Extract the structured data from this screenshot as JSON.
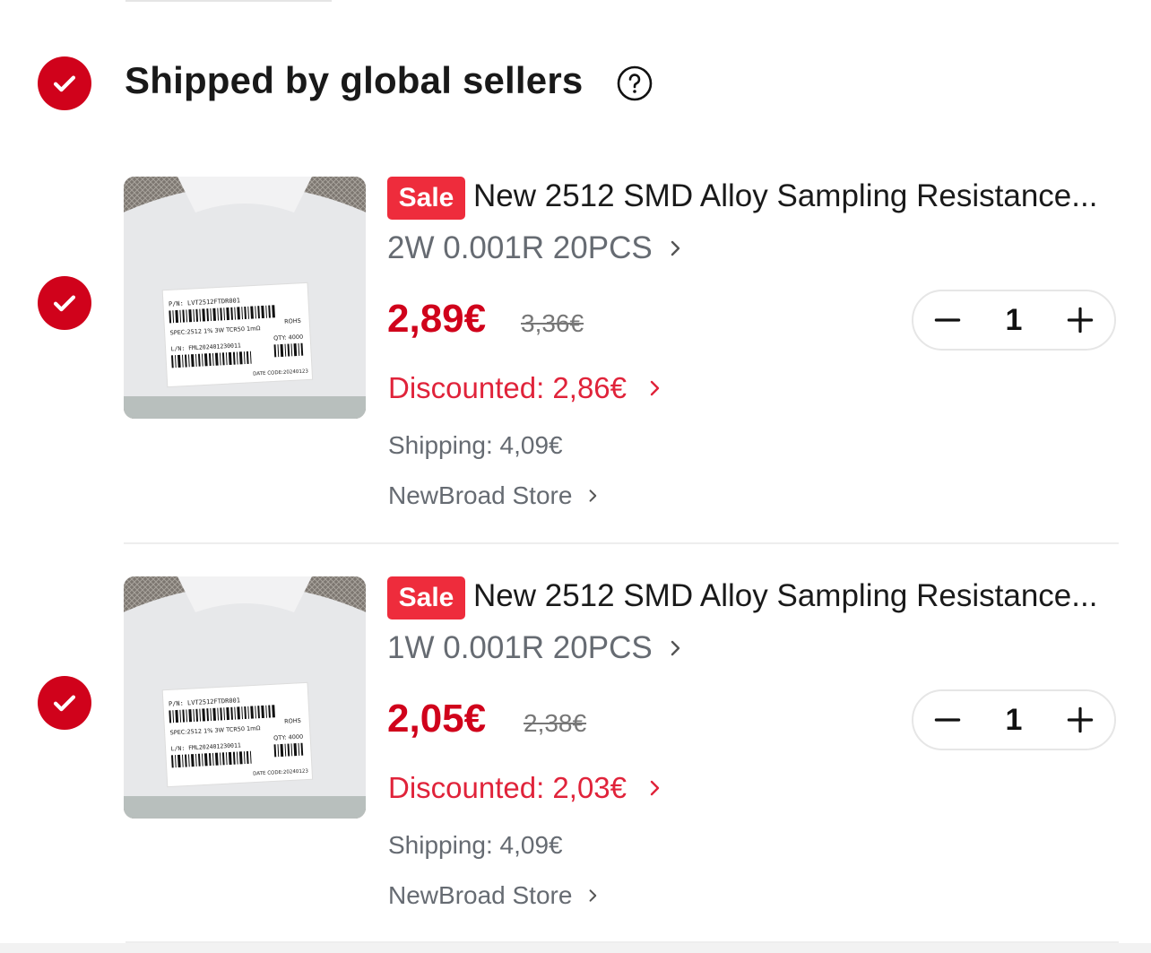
{
  "section": {
    "title": "Shipped by global sellers",
    "help_icon": "question-circle-icon",
    "checked": true
  },
  "colors": {
    "accent": "#d0021b",
    "sale_badge": "#ee2c3c",
    "discount_text": "#e0233a",
    "muted_text": "#666b72"
  },
  "items": [
    {
      "checked": true,
      "image_label": {
        "pn": "P/N: LVT2512FTDR001",
        "spec": "SPEC:2512 1% 3W TCR50 1mΩ",
        "rohs": "ROHS",
        "ln": "L/N: FML202401230011",
        "qty": "QTY: 4000",
        "date": "DATE CODE:20240123"
      },
      "badge": "Sale",
      "title": "New 2512 SMD Alloy Sampling Resistance...",
      "variant": "2W 0.001R 20PCS",
      "price": "2,89€",
      "old_price": "3,36€",
      "discount": "Discounted: 2,86€",
      "shipping": "Shipping: 4,09€",
      "store": "NewBroad Store",
      "quantity": "1"
    },
    {
      "checked": true,
      "image_label": {
        "pn": "P/N: LVT2512FTDR001",
        "spec": "SPEC:2512 1% 3W TCR50 1mΩ",
        "rohs": "ROHS",
        "ln": "L/N: FML202401230011",
        "qty": "QTY: 4000",
        "date": "DATE CODE:20240123"
      },
      "badge": "Sale",
      "title": "New 2512 SMD Alloy Sampling Resistance...",
      "variant": "1W 0.001R 20PCS",
      "price": "2,05€",
      "old_price": "2,38€",
      "discount": "Discounted: 2,03€",
      "shipping": "Shipping: 4,09€",
      "store": "NewBroad Store",
      "quantity": "1"
    }
  ]
}
